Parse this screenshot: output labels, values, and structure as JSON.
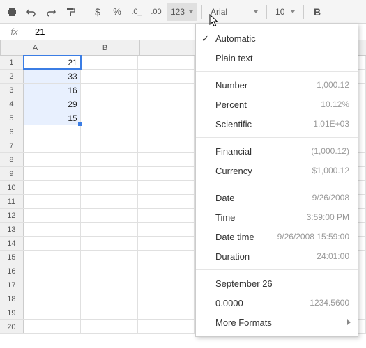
{
  "toolbar": {
    "format_btn_label": "123",
    "font_name": "Arial",
    "font_size": "10",
    "bold_label": "B"
  },
  "fx": {
    "label": "fx",
    "value": "21"
  },
  "columns": [
    "A",
    "B"
  ],
  "row_count": 20,
  "cells": {
    "A1": "21",
    "A2": "33",
    "A3": "16",
    "A4": "29",
    "A5": "15"
  },
  "selection": {
    "col": "A",
    "from": 1,
    "to": 5,
    "active": 1
  },
  "menu": {
    "items": [
      {
        "label": "Automatic",
        "checked": true
      },
      {
        "label": "Plain text"
      },
      {
        "sep": true
      },
      {
        "label": "Number",
        "example": "1,000.12"
      },
      {
        "label": "Percent",
        "example": "10.12%"
      },
      {
        "label": "Scientific",
        "example": "1.01E+03"
      },
      {
        "sep": true
      },
      {
        "label": "Financial",
        "example": "(1,000.12)"
      },
      {
        "label": "Currency",
        "example": "$1,000.12"
      },
      {
        "sep": true
      },
      {
        "label": "Date",
        "example": "9/26/2008"
      },
      {
        "label": "Time",
        "example": "3:59:00 PM"
      },
      {
        "label": "Date time",
        "example": "9/26/2008 15:59:00"
      },
      {
        "label": "Duration",
        "example": "24:01:00"
      },
      {
        "sep": true
      },
      {
        "label": "September 26"
      },
      {
        "label": "0.0000",
        "example": "1234.5600"
      },
      {
        "label": "More Formats",
        "submenu": true
      }
    ]
  }
}
